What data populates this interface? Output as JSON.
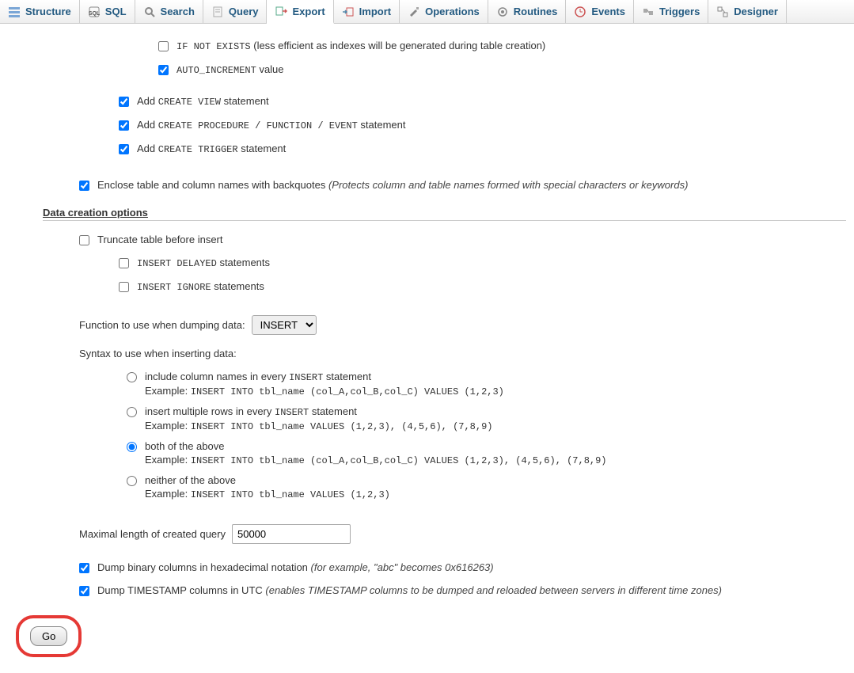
{
  "tabs": {
    "structure": "Structure",
    "sql": "SQL",
    "search": "Search",
    "query": "Query",
    "export": "Export",
    "import": "Import",
    "operations": "Operations",
    "routines": "Routines",
    "events": "Events",
    "triggers": "Triggers",
    "designer": "Designer"
  },
  "opts": {
    "ifNotExistsCode": "IF NOT EXISTS",
    "ifNotExistsHint": " (less efficient as indexes will be generated during table creation)",
    "autoIncCode": "AUTO_INCREMENT",
    "autoIncSuffix": " value",
    "addPrefix": "Add ",
    "createViewCode": "CREATE VIEW",
    "statementSuffix": " statement",
    "createProcCode": "CREATE PROCEDURE / FUNCTION / EVENT",
    "createTriggerCode": "CREATE TRIGGER",
    "encloseLabel": "Enclose table and column names with backquotes ",
    "encloseHint": "(Protects column and table names formed with special characters or keywords)",
    "dataSection": "Data creation options",
    "truncateLabel": "Truncate table before insert",
    "insertDelayedCode": "INSERT DELAYED",
    "statementsSuffix": " statements",
    "insertIgnoreCode": "INSERT IGNORE",
    "functionToUse": "Function to use when dumping data:",
    "functionValue": "INSERT",
    "syntaxLabel": "Syntax to use when inserting data:",
    "r1": "include column names in every ",
    "r1code": "INSERT",
    "r1suffix": " statement",
    "r1ex": "INSERT INTO tbl_name (col_A,col_B,col_C) VALUES (1,2,3)",
    "r2": "insert multiple rows in every ",
    "r2code": "INSERT",
    "r2suffix": " statement",
    "r2ex": "INSERT INTO tbl_name VALUES (1,2,3), (4,5,6), (7,8,9)",
    "r3": "both of the above",
    "r3ex": "INSERT INTO tbl_name (col_A,col_B,col_C) VALUES (1,2,3), (4,5,6), (7,8,9)",
    "r4": "neither of the above",
    "r4ex": "INSERT INTO tbl_name VALUES (1,2,3)",
    "exampleLabel": "Example: ",
    "maxLenLabel": "Maximal length of created query",
    "maxLenValue": "50000",
    "dumpBinLabel": "Dump binary columns in hexadecimal notation ",
    "dumpBinHint": "(for example, \"abc\" becomes 0x616263)",
    "dumpTsLabel": "Dump TIMESTAMP columns in UTC ",
    "dumpTsHint": "(enables TIMESTAMP columns to be dumped and reloaded between servers in different time zones)",
    "goLabel": "Go"
  }
}
